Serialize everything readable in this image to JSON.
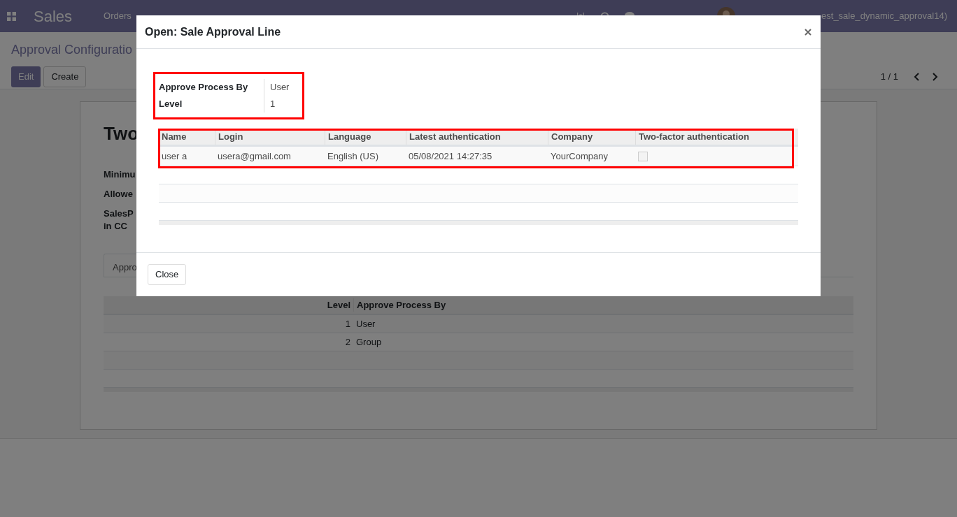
{
  "navbar": {
    "app": "Sales",
    "menu": [
      "Orders"
    ],
    "user": "est_sale_dynamic_approval14)"
  },
  "control_panel": {
    "breadcrumb": "Approval Configuratio",
    "buttons": [
      {
        "label": "Edit",
        "kind": "primary"
      },
      {
        "label": "Create",
        "kind": "secondary"
      }
    ],
    "pager": "1 / 1"
  },
  "form": {
    "title": "Two",
    "fields": [
      {
        "lines": [
          "Minimu"
        ]
      },
      {
        "lines": [
          "Allowe"
        ]
      },
      {
        "lines": [
          "SalesP",
          "in CC"
        ]
      }
    ],
    "tab": "Appro",
    "table": {
      "columns": [
        "Level",
        "Approve Process By"
      ],
      "rows": [
        {
          "level": "1",
          "process": "User"
        },
        {
          "level": "2",
          "process": "Group"
        }
      ]
    }
  },
  "dialog": {
    "title": "Open: Sale Approval Line",
    "fields": [
      {
        "label": "Approve Process By",
        "value": "User"
      },
      {
        "label": "Level",
        "value": "1"
      }
    ],
    "table": {
      "columns": [
        "Name",
        "Login",
        "Language",
        "Latest authentication",
        "Company",
        "Two-factor authentication"
      ],
      "rows": [
        {
          "name": "user a",
          "login": "usera@gmail.com",
          "language": "English (US)",
          "latest_authentication": "05/08/2021 14:27:35",
          "company": "YourCompany",
          "two_factor": false
        }
      ]
    },
    "button": "Close"
  }
}
